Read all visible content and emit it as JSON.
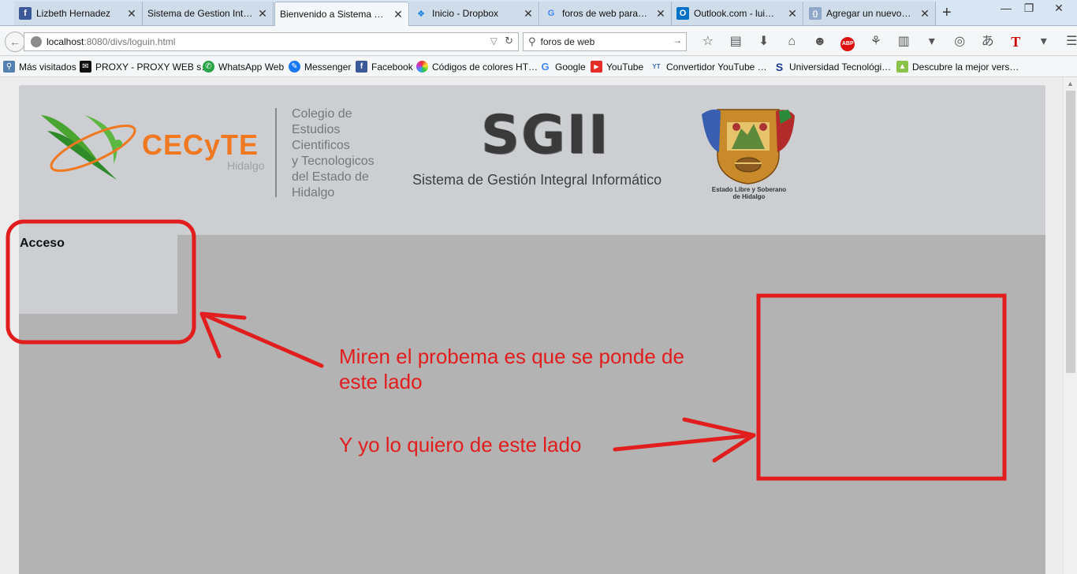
{
  "tabs": [
    {
      "title": "Lizbeth Hernadez",
      "icon": "facebook-icon",
      "color": "#3b5998",
      "glyph": "f",
      "active": false
    },
    {
      "title": "Sistema de Gestion Int…",
      "icon": "none",
      "color": "",
      "glyph": "",
      "active": false
    },
    {
      "title": "Bienvenido a Sistema …",
      "icon": "none",
      "color": "",
      "glyph": "",
      "active": true
    },
    {
      "title": "Inicio - Dropbox",
      "icon": "dropbox-icon",
      "color": "#0d7ee6",
      "glyph": "❖",
      "active": false
    },
    {
      "title": "foros de web para…",
      "icon": "google-icon",
      "color": "#4285f4",
      "glyph": "G",
      "active": false
    },
    {
      "title": "Outlook.com - lui…",
      "icon": "outlook-icon",
      "color": "#0072c6",
      "glyph": "O",
      "active": false
    },
    {
      "title": "Agregar un nuevo…",
      "icon": "page-icon",
      "color": "#8fa7c9",
      "glyph": "{}",
      "active": false
    }
  ],
  "nav": {
    "url_host": "localhost",
    "url_path": ":8080/divs/loguin.html",
    "search_value": "foros de web"
  },
  "bookmarks": [
    {
      "label": "Más visitados",
      "icon": "most-visited-icon",
      "color": "#5580b0",
      "glyph": "⚲"
    },
    {
      "label": "PROXY - PROXY WEB s…",
      "icon": "proxy-icon",
      "color": "#111111",
      "glyph": "✉"
    },
    {
      "label": "WhatsApp Web",
      "icon": "whatsapp-icon",
      "color": "#25a244",
      "glyph": "✆"
    },
    {
      "label": "Messenger",
      "icon": "messenger-icon",
      "color": "#1877f2",
      "glyph": "✎"
    },
    {
      "label": "Facebook",
      "icon": "facebook-icon",
      "color": "#3b5998",
      "glyph": "f"
    },
    {
      "label": "Códigos de colores HT…",
      "icon": "color-wheel-icon",
      "color": "#d23ad2",
      "glyph": "●"
    },
    {
      "label": "Google",
      "icon": "google-icon",
      "color": "#4285f4",
      "glyph": "G"
    },
    {
      "label": "YouTube",
      "icon": "youtube-icon",
      "color": "#e52d27",
      "glyph": "▶"
    },
    {
      "label": "Convertidor YouTube …",
      "icon": "ytmp3-icon",
      "color": "#3a68b0",
      "glyph": "Y"
    },
    {
      "label": "Universidad Tecnológi…",
      "icon": "university-icon",
      "color": "#1a3d8f",
      "glyph": "S"
    },
    {
      "label": "Descubre la mejor vers…",
      "icon": "android-icon",
      "color": "#8bc34a",
      "glyph": "▲"
    }
  ],
  "header": {
    "cecyte_word": "CECyTE",
    "cecyte_sub": "Hidalgo",
    "college_lines": [
      "Colegio de",
      "Estudios",
      "Cientificos",
      "y Tecnologicos",
      "del Estado de",
      "Hidalgo"
    ],
    "sgii_title": "SGII",
    "sgii_subtitle": "Sistema de Gestión Integral Informático",
    "shield_text_1": "Estado Libre y Soberano",
    "shield_text_2": "de Hidalgo"
  },
  "acceso": {
    "title": "Acceso"
  },
  "annotations": {
    "line1": "Miren el probema es que se ponde de este lado",
    "line2": "Y yo lo quiero de este lado",
    "color": "#e11d1d"
  }
}
